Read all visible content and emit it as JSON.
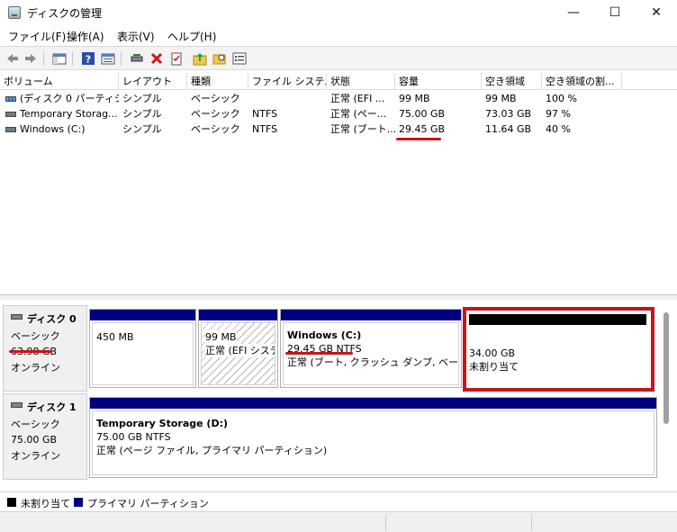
{
  "window": {
    "title": "ディスクの管理",
    "minimize_glyph": "—",
    "maximize_glyph": "☐",
    "close_glyph": "✕"
  },
  "menu": [
    "ファイル(F)",
    "操作(A)",
    "表示(V)",
    "ヘルプ(H)"
  ],
  "toolbar": {
    "icons": [
      "back-arrow-icon",
      "forward-arrow-icon",
      "console-tree-icon",
      "help-icon",
      "properties-icon",
      "connect-disk-icon",
      "delete-icon",
      "checklist-icon",
      "up-folder-icon",
      "search-folder-icon",
      "settings-list-icon"
    ]
  },
  "volume_list": {
    "columns": [
      "ボリューム",
      "レイアウト",
      "種類",
      "ファイル システム",
      "状態",
      "容量",
      "空き領域",
      "空き領域の割...",
      ""
    ],
    "rows": [
      {
        "volume": "(ディスク 0 パーティシ...",
        "layout": "シンプル",
        "type": "ベーシック",
        "fs": "",
        "status": "正常 (EFI ...",
        "capacity": "99 MB",
        "free": "99 MB",
        "free_pct": "100 %",
        "icon": "efi-volume-icon"
      },
      {
        "volume": "Temporary Storag...",
        "layout": "シンプル",
        "type": "ベーシック",
        "fs": "NTFS",
        "status": "正常 (ペー...",
        "capacity": "75.00 GB",
        "free": "73.03 GB",
        "free_pct": "97 %",
        "icon": "volume-icon"
      },
      {
        "volume": "Windows (C:)",
        "layout": "シンプル",
        "type": "ベーシック",
        "fs": "NTFS",
        "status": "正常 (ブート...",
        "capacity": "29.45 GB",
        "free": "11.64 GB",
        "free_pct": "40 %",
        "icon": "volume-icon"
      }
    ]
  },
  "disks": [
    {
      "name": "ディスク 0",
      "type": "ベーシック",
      "size": "63.98 GB",
      "state": "オンライン",
      "partitions": [
        {
          "size": "450 MB",
          "status": ""
        },
        {
          "size": "99 MB",
          "status": "正常 (EFI システ"
        },
        {
          "title": "Windows  (C:)",
          "size": "29.45 GB NTFS",
          "status": "正常 (ブート, クラッシュ ダンプ, ベーシック"
        },
        {
          "size": "34.00 GB",
          "status": "未割り当て"
        }
      ]
    },
    {
      "name": "ディスク 1",
      "type": "ベーシック",
      "size": "75.00 GB",
      "state": "オンライン",
      "partitions": [
        {
          "title": "Temporary Storage  (D:)",
          "size": "75.00 GB NTFS",
          "status": "正常 (ページ ファイル, プライマリ パーティション)"
        }
      ]
    }
  ],
  "legend": [
    {
      "label": "未割り当て",
      "color": "#000000"
    },
    {
      "label": "プライマリ パーティション",
      "color": "#00007f"
    }
  ],
  "colors": {
    "primary_partition": "#00007f",
    "unallocated": "#000000",
    "annotation_red": "#c4161c"
  }
}
